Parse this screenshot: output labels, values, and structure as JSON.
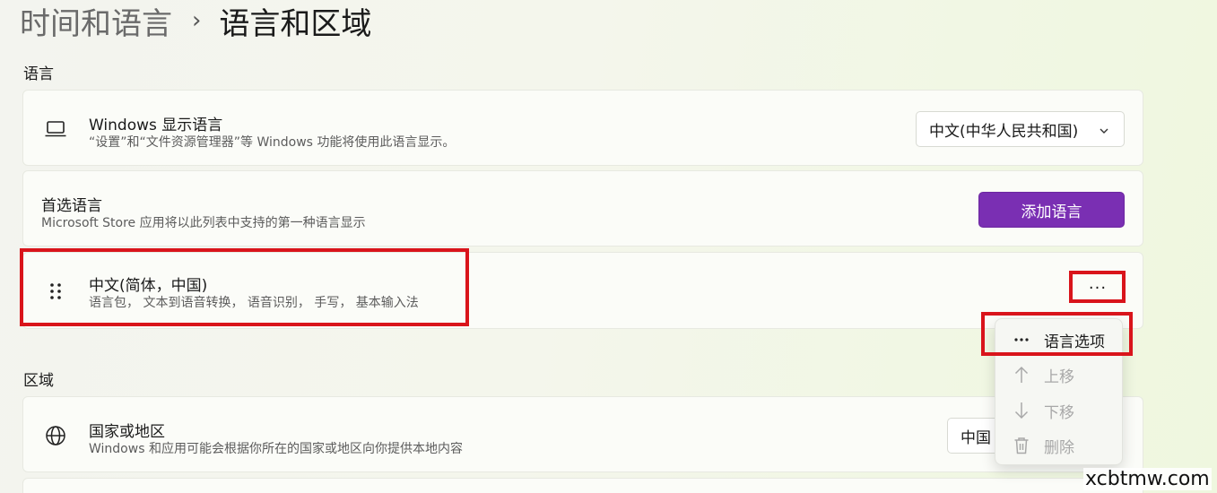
{
  "breadcrumb": {
    "parent": "时间和语言",
    "separator": "›",
    "current": "语言和区域"
  },
  "sections": {
    "language": "语言",
    "region": "区域"
  },
  "display_language": {
    "icon": "laptop-icon",
    "title": "Windows 显示语言",
    "subtitle": "“设置”和“文件资源管理器”等 Windows 功能将使用此语言显示。",
    "selected": "中文(中华人民共和国)"
  },
  "preferred_language": {
    "title": "首选语言",
    "subtitle": "Microsoft Store 应用将以此列表中支持的第一种语言显示",
    "add_button": "添加语言"
  },
  "language_item": {
    "icon": "drag-handle-icon",
    "title": "中文(简体，中国)",
    "subtitle": "语言包， 文本到语音转换， 语音识别， 手写， 基本输入法",
    "more_button": "···"
  },
  "context_menu": {
    "items": [
      {
        "icon": "more-icon",
        "label": "语言选项",
        "enabled": true
      },
      {
        "icon": "arrow-up-icon",
        "label": "上移",
        "enabled": false
      },
      {
        "icon": "arrow-down-icon",
        "label": "下移",
        "enabled": false
      },
      {
        "icon": "trash-icon",
        "label": "删除",
        "enabled": false
      }
    ]
  },
  "country_region": {
    "icon": "globe-icon",
    "title": "国家或地区",
    "subtitle": "Windows 和应用可能会根据你所在的国家或地区向你提供本地内容",
    "selected": "中国"
  },
  "watermark": "xcbtmw.com",
  "colors": {
    "accent": "#7a2fb3",
    "highlight": "#d9141b"
  }
}
